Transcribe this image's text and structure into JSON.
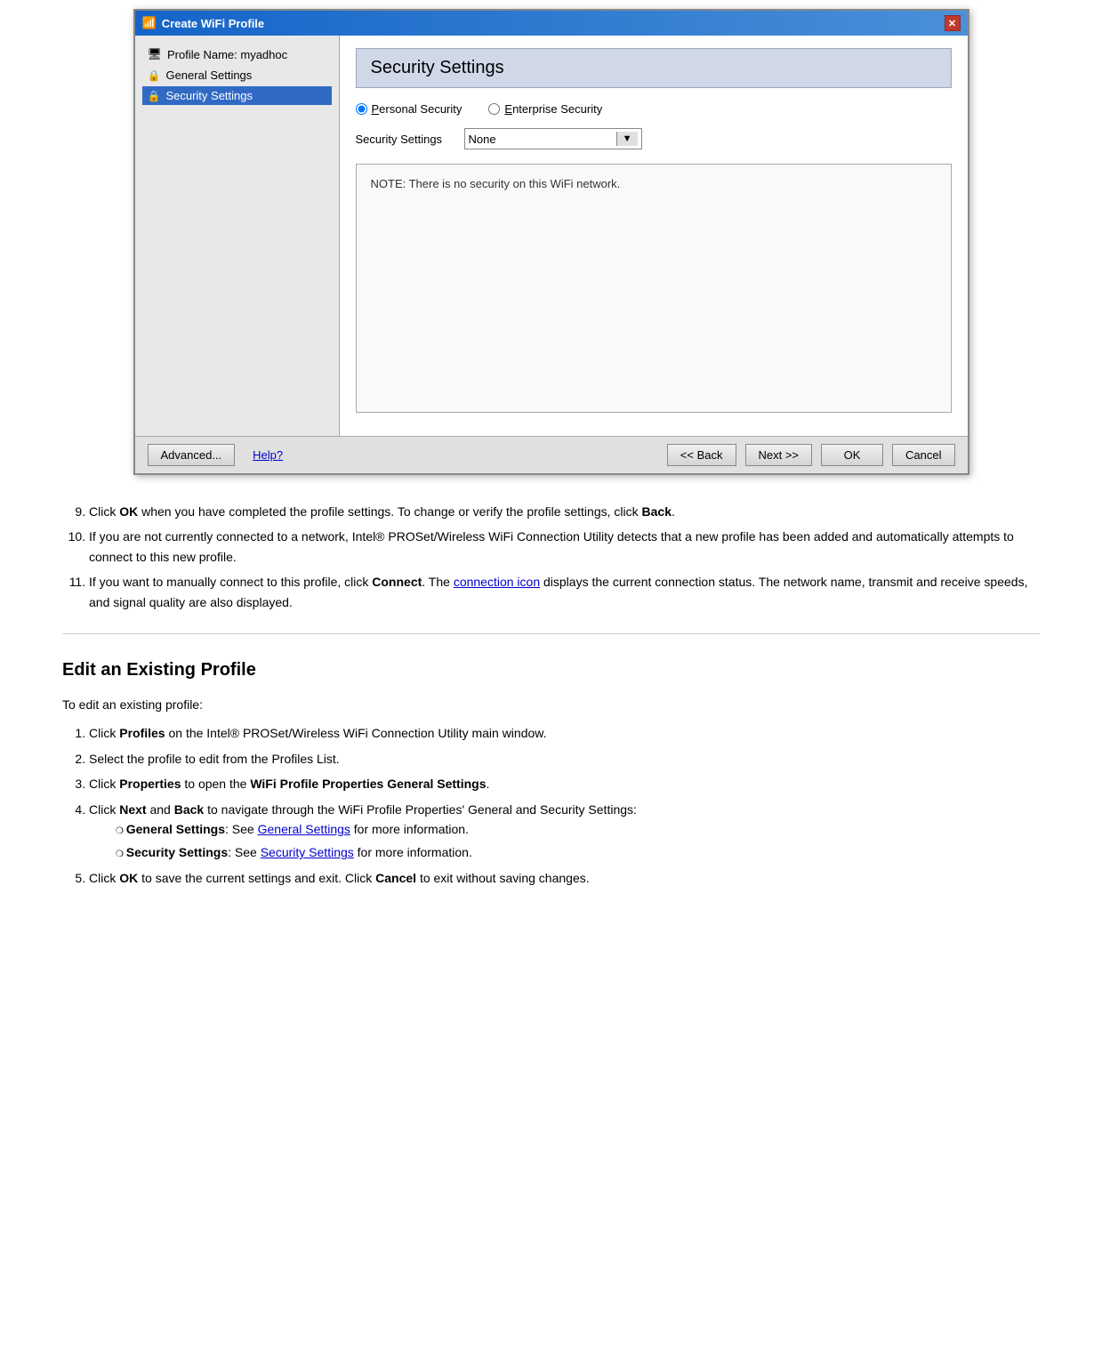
{
  "dialog": {
    "title": "Create WiFi Profile",
    "nav": {
      "items": [
        {
          "id": "profile-name",
          "label": "Profile Name: myadhoc",
          "icon": "computer",
          "selected": false
        },
        {
          "id": "general-settings",
          "label": "General Settings",
          "icon": "lock",
          "selected": false
        },
        {
          "id": "security-settings",
          "label": "Security Settings",
          "icon": "lock",
          "selected": true
        }
      ]
    },
    "content": {
      "header": "Security Settings",
      "radio_personal_label": "Personal Security",
      "radio_personal_underline_char": "P",
      "radio_enterprise_label": "Enterprise Security",
      "radio_enterprise_underline_char": "E",
      "personal_selected": true,
      "settings_label": "Security Settings",
      "dropdown_value": "None",
      "note_text": "NOTE: There is no security on this WiFi network."
    },
    "footer": {
      "advanced_label": "Advanced...",
      "help_label": "Help?",
      "back_label": "<< Back",
      "next_label": "Next >>",
      "ok_label": "OK",
      "cancel_label": "Cancel"
    }
  },
  "page": {
    "steps_9_to_11": [
      {
        "num": "9.",
        "text_parts": [
          {
            "text": "Click ",
            "bold": false
          },
          {
            "text": "OK",
            "bold": true
          },
          {
            "text": " when you have completed the profile settings. To change or verify the profile settings, click ",
            "bold": false
          },
          {
            "text": "Back",
            "bold": true
          },
          {
            "text": ".",
            "bold": false
          }
        ]
      },
      {
        "num": "10.",
        "text_parts": [
          {
            "text": "If you are not currently connected to a network, Intel® PROSet/Wireless WiFi Connection Utility detects that a new profile has been added and automatically attempts to connect to this new profile.",
            "bold": false
          }
        ]
      },
      {
        "num": "11.",
        "text_parts": [
          {
            "text": "If you want to manually connect to this profile, click ",
            "bold": false
          },
          {
            "text": "Connect",
            "bold": true
          },
          {
            "text": ". The ",
            "bold": false
          },
          {
            "text": "connection icon",
            "bold": false,
            "link": true
          },
          {
            "text": " displays the current connection status. The network name, transmit and receive speeds, and signal quality are also displayed.",
            "bold": false
          }
        ]
      }
    ],
    "edit_section": {
      "heading": "Edit an Existing Profile",
      "intro": "To edit an existing profile:",
      "steps": [
        {
          "num": 1,
          "text_parts": [
            {
              "text": "Click ",
              "bold": false
            },
            {
              "text": "Profiles",
              "bold": true
            },
            {
              "text": " on the Intel® PROSet/Wireless WiFi Connection Utility main window.",
              "bold": false
            }
          ]
        },
        {
          "num": 2,
          "text_parts": [
            {
              "text": "Select the profile to edit from the Profiles List.",
              "bold": false
            }
          ]
        },
        {
          "num": 3,
          "text_parts": [
            {
              "text": "Click ",
              "bold": false
            },
            {
              "text": "Properties",
              "bold": true
            },
            {
              "text": " to open the ",
              "bold": false
            },
            {
              "text": "WiFi Profile Properties General Settings",
              "bold": true
            },
            {
              "text": ".",
              "bold": false
            }
          ]
        },
        {
          "num": 4,
          "text_parts": [
            {
              "text": "Click ",
              "bold": false
            },
            {
              "text": "Next",
              "bold": true
            },
            {
              "text": " and ",
              "bold": false
            },
            {
              "text": "Back",
              "bold": true
            },
            {
              "text": " to navigate through the WiFi Profile Properties' General and Security Settings:",
              "bold": false
            }
          ],
          "sub_items": [
            {
              "label": "General Settings",
              "link_text": "General Settings",
              "suffix": " for more information."
            },
            {
              "label": "Security Settings",
              "link_text": "Security Settings",
              "suffix": " for more information."
            }
          ]
        },
        {
          "num": 5,
          "text_parts": [
            {
              "text": "Click ",
              "bold": false
            },
            {
              "text": "OK",
              "bold": true
            },
            {
              "text": " to save the current settings and exit. Click ",
              "bold": false
            },
            {
              "text": "Cancel",
              "bold": true
            },
            {
              "text": " to exit without saving changes.",
              "bold": false
            }
          ]
        }
      ]
    }
  }
}
